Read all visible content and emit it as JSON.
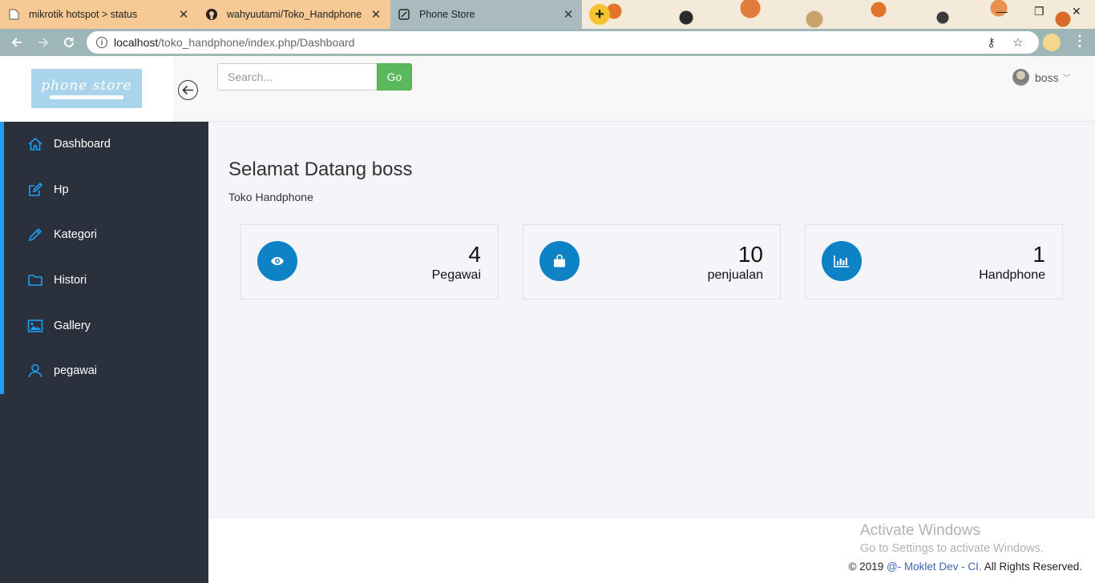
{
  "browser": {
    "tabs": [
      {
        "title": "mikrotik hotspot > status",
        "close": "✕"
      },
      {
        "title": "wahyuutami/Toko_Handphone",
        "close": "✕"
      },
      {
        "title": "Phone Store",
        "close": "✕"
      }
    ],
    "new_tab": "+",
    "url_host": "localhost",
    "url_path": "/toko_handphone/index.php/Dashboard"
  },
  "header": {
    "logo_text": "phone store",
    "search_placeholder": "Search...",
    "search_value": "",
    "go_label": "Go",
    "user_name": "boss"
  },
  "sidebar": {
    "items": [
      {
        "label": "Dashboard",
        "icon": "home-icon"
      },
      {
        "label": "Hp",
        "icon": "edit-icon"
      },
      {
        "label": "Kategori",
        "icon": "pencil-icon"
      },
      {
        "label": "Histori",
        "icon": "folder-icon"
      },
      {
        "label": "Gallery",
        "icon": "image-icon"
      },
      {
        "label": "pegawai",
        "icon": "user-icon"
      }
    ]
  },
  "main": {
    "title": "Selamat Datang boss",
    "subtitle": "Toko Handphone",
    "cards": [
      {
        "value": "4",
        "label": "Pegawai",
        "icon": "eye-icon"
      },
      {
        "value": "10",
        "label": "penjualan",
        "icon": "shopping-bag-icon"
      },
      {
        "value": "1",
        "label": "Handphone",
        "icon": "bar-chart-icon"
      }
    ]
  },
  "footer": {
    "copyright_prefix": "© 2019 ",
    "copyright_link": "@- Moklet Dev - CI.",
    "copyright_suffix": " All Rights Reserved."
  },
  "watermark": {
    "line1": "Activate Windows",
    "line2": "Go to Settings to activate Windows."
  },
  "colors": {
    "sidebar_bg": "#2a303c",
    "sidebar_accent": "#1e9ff2",
    "card_icon_bg": "#0d82c5",
    "go_button": "#5cb85c"
  }
}
